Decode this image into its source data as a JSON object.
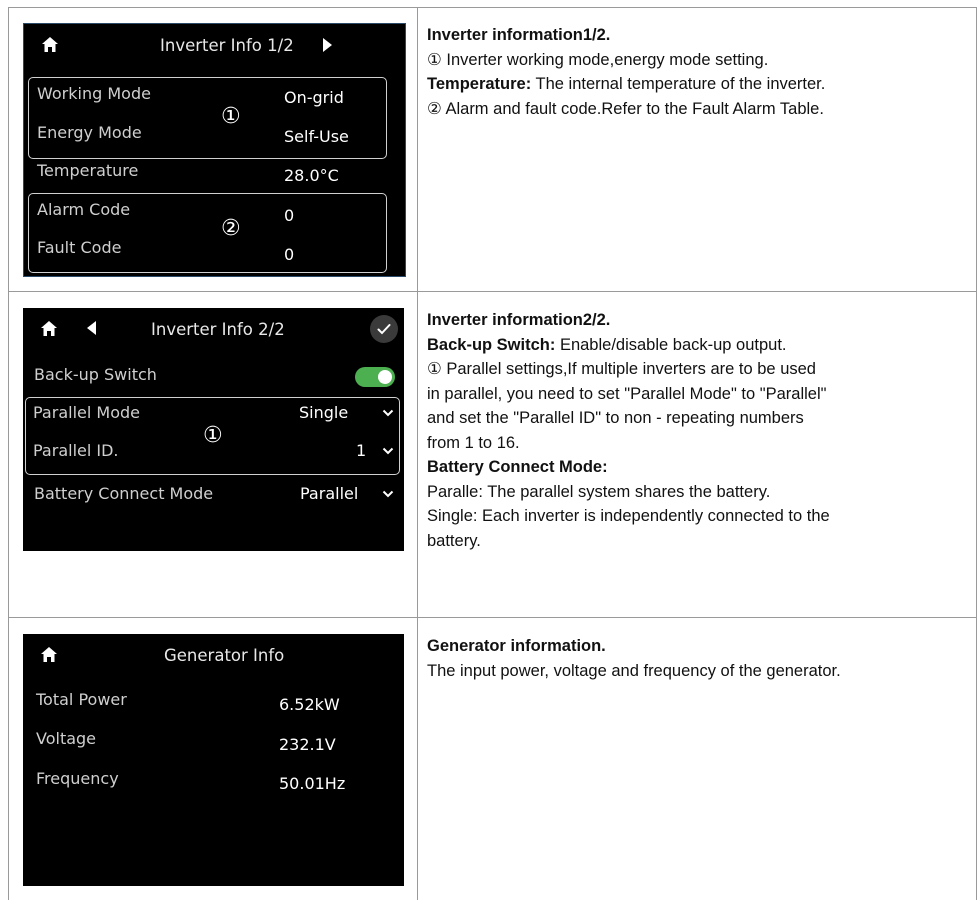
{
  "rows": [
    {
      "screen": {
        "title": "Inverter Info 1/2",
        "fields": [
          {
            "label": "Working Mode",
            "value": "On-grid"
          },
          {
            "label": "Energy Mode",
            "value": "Self-Use"
          },
          {
            "label": "Temperature",
            "value": "28.0°C"
          },
          {
            "label": "Alarm Code",
            "value": "0"
          },
          {
            "label": "Fault Code",
            "value": "0"
          }
        ],
        "markers": [
          "①",
          "②"
        ]
      },
      "desc": {
        "heading": "Inverter information1/2.",
        "line1": "① Inverter working mode,energy mode setting.",
        "temp_term": "Temperature:",
        "temp_text": " The internal temperature of the inverter.",
        "line3": "② Alarm and fault code.Refer to the Fault Alarm Table."
      }
    },
    {
      "screen": {
        "title": "Inverter Info 2/2",
        "fields": [
          {
            "label": "Back-up Switch",
            "value": ""
          },
          {
            "label": "Parallel Mode",
            "value": "Single"
          },
          {
            "label": "Parallel ID.",
            "value": "1"
          },
          {
            "label": "Battery Connect Mode",
            "value": "Parallel"
          }
        ],
        "markers": [
          "①"
        ]
      },
      "desc": {
        "heading": "Inverter information2/2.",
        "backup_term": "Back-up Switch:",
        "backup_text": " Enable/disable back-up output.",
        "parallel_lines": [
          "① Parallel settings,If multiple inverters are to be used",
          "in parallel, you need to set \"Parallel Mode\" to \"Parallel\"",
          "and set the \"Parallel ID\" to non - repeating numbers",
          "from 1 to 16."
        ],
        "bcm_term": "Battery Connect Mode:",
        "bcm_lines": [
          "Paralle: The parallel system shares the battery.",
          "Single: Each inverter is independently connected to the",
          "battery."
        ]
      }
    },
    {
      "screen": {
        "title": "Generator Info",
        "fields": [
          {
            "label": "Total Power",
            "value": "6.52kW"
          },
          {
            "label": "Voltage",
            "value": "232.1V"
          },
          {
            "label": "Frequency",
            "value": "50.01Hz"
          }
        ]
      },
      "desc": {
        "heading": "Generator information.",
        "line1": "The input power, voltage and frequency of the generator."
      }
    }
  ],
  "icons": {
    "home": "home-icon",
    "next": "triangle-right-icon",
    "prev": "triangle-left-icon",
    "confirm": "check-icon",
    "toggle": "toggle-switch",
    "dropdown": "chevron-down-icon"
  },
  "colors": {
    "screen_bg": "#000000",
    "toggle_on": "#4caf50",
    "group_border": "#d0d0d0"
  },
  "states": {
    "backup_switch_on": true
  }
}
